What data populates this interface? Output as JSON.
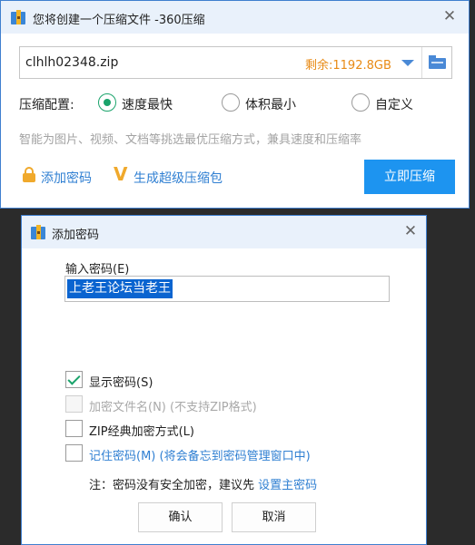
{
  "main_window": {
    "title": "您将创建一个压缩文件 -360压缩",
    "path_value": "clhlh02348.zip",
    "remaining_space": "剩余:1192.8GB",
    "config_label": "压缩配置:",
    "options": [
      {
        "label": "速度最快",
        "selected": true
      },
      {
        "label": "体积最小",
        "selected": false
      },
      {
        "label": "自定义",
        "selected": false
      }
    ],
    "hint": "智能为图片、视频、文档等挑选最优压缩方式，兼具速度和压缩率",
    "add_password_link": "添加密码",
    "super_package_link": "生成超级压缩包",
    "compress_button": "立即压缩"
  },
  "password_dialog": {
    "title": "添加密码",
    "field_label": "输入密码(E)",
    "password_value": "上老王论坛当老王",
    "checkboxes": [
      {
        "label": "显示密码(S)",
        "checked": true,
        "enabled": true
      },
      {
        "label": "加密文件名(N) (不支持ZIP格式)",
        "checked": false,
        "enabled": false
      },
      {
        "label": "ZIP经典加密方式(L)",
        "checked": false,
        "enabled": true
      },
      {
        "label": "记住密码(M) (将会备忘到密码管理窗口中)",
        "checked": false,
        "enabled": true
      }
    ],
    "note_prefix": "注：密码没有安全加密，建议先 ",
    "note_link": "设置主密码",
    "ok_button": "确认",
    "cancel_button": "取消"
  },
  "colors": {
    "accent_blue": "#1d94f0",
    "link_blue": "#2f7fd2",
    "green_check": "#1aa36b",
    "orange": "#e88a14"
  }
}
